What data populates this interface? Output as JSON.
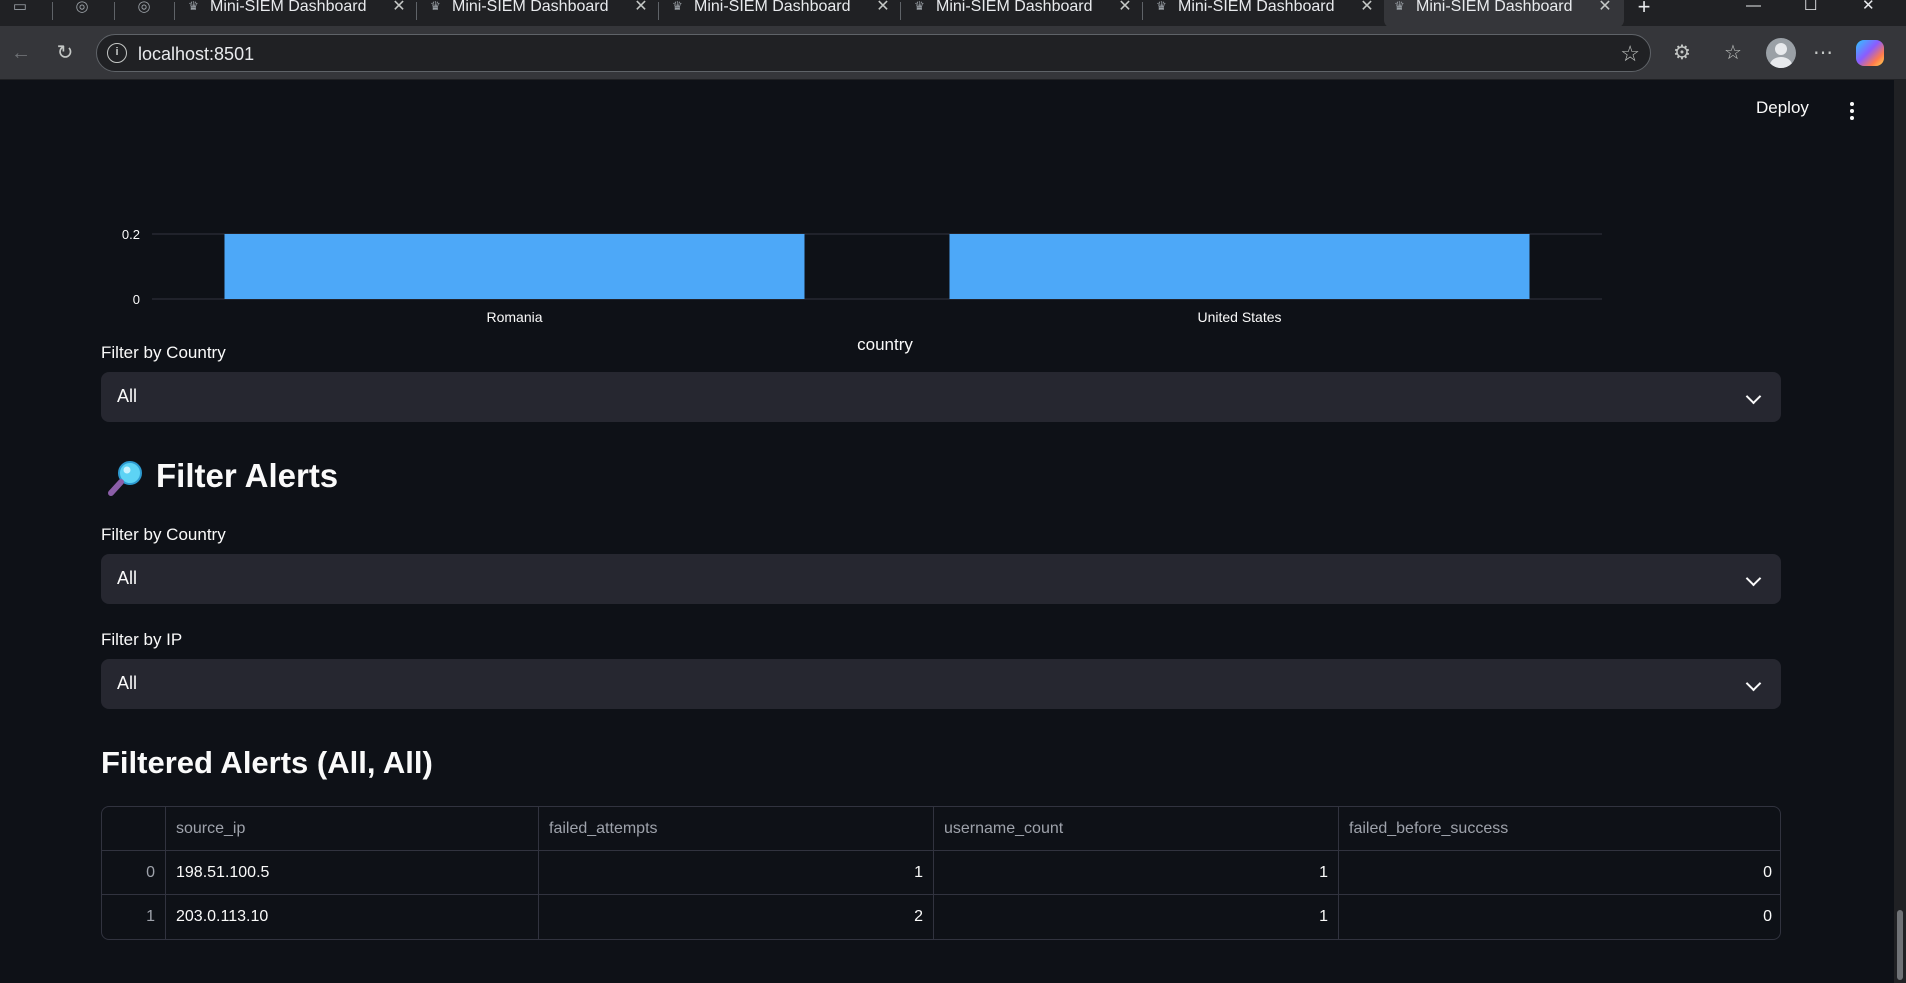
{
  "browser": {
    "tabs": [
      {
        "title": "Mini-SIEM Dashboard",
        "active": false
      },
      {
        "title": "Mini-SIEM Dashboard",
        "active": false
      },
      {
        "title": "Mini-SIEM Dashboard",
        "active": false
      },
      {
        "title": "Mini-SIEM Dashboard",
        "active": false
      },
      {
        "title": "Mini-SIEM Dashboard",
        "active": false
      },
      {
        "title": "Mini-SIEM Dashboard",
        "active": true
      }
    ],
    "url": "localhost:8501"
  },
  "header": {
    "deploy_label": "Deploy"
  },
  "chart_data": {
    "type": "bar",
    "categories": [
      "Romania",
      "United States"
    ],
    "values": [
      0.2,
      0.2
    ],
    "xlabel": "country",
    "yticks": [
      "0",
      "0.2"
    ],
    "bar_color": "#4da8f8",
    "note": "chart is scrolled; only the bottom portion is visible"
  },
  "country_filter_top": {
    "label": "Filter by Country",
    "value": "All"
  },
  "filter_alerts": {
    "title": "Filter Alerts",
    "icon": "magnifier-icon",
    "country": {
      "label": "Filter by Country",
      "value": "All"
    },
    "ip": {
      "label": "Filter by IP",
      "value": "All"
    }
  },
  "filtered": {
    "title": "Filtered Alerts (All, All)",
    "columns": [
      "",
      "source_ip",
      "failed_attempts",
      "username_count",
      "failed_before_success"
    ],
    "rows": [
      {
        "index": "0",
        "source_ip": "198.51.100.5",
        "failed_attempts": "1",
        "username_count": "1",
        "failed_before_success": "0"
      },
      {
        "index": "1",
        "source_ip": "203.0.113.10",
        "failed_attempts": "2",
        "username_count": "1",
        "failed_before_success": "0"
      }
    ]
  }
}
